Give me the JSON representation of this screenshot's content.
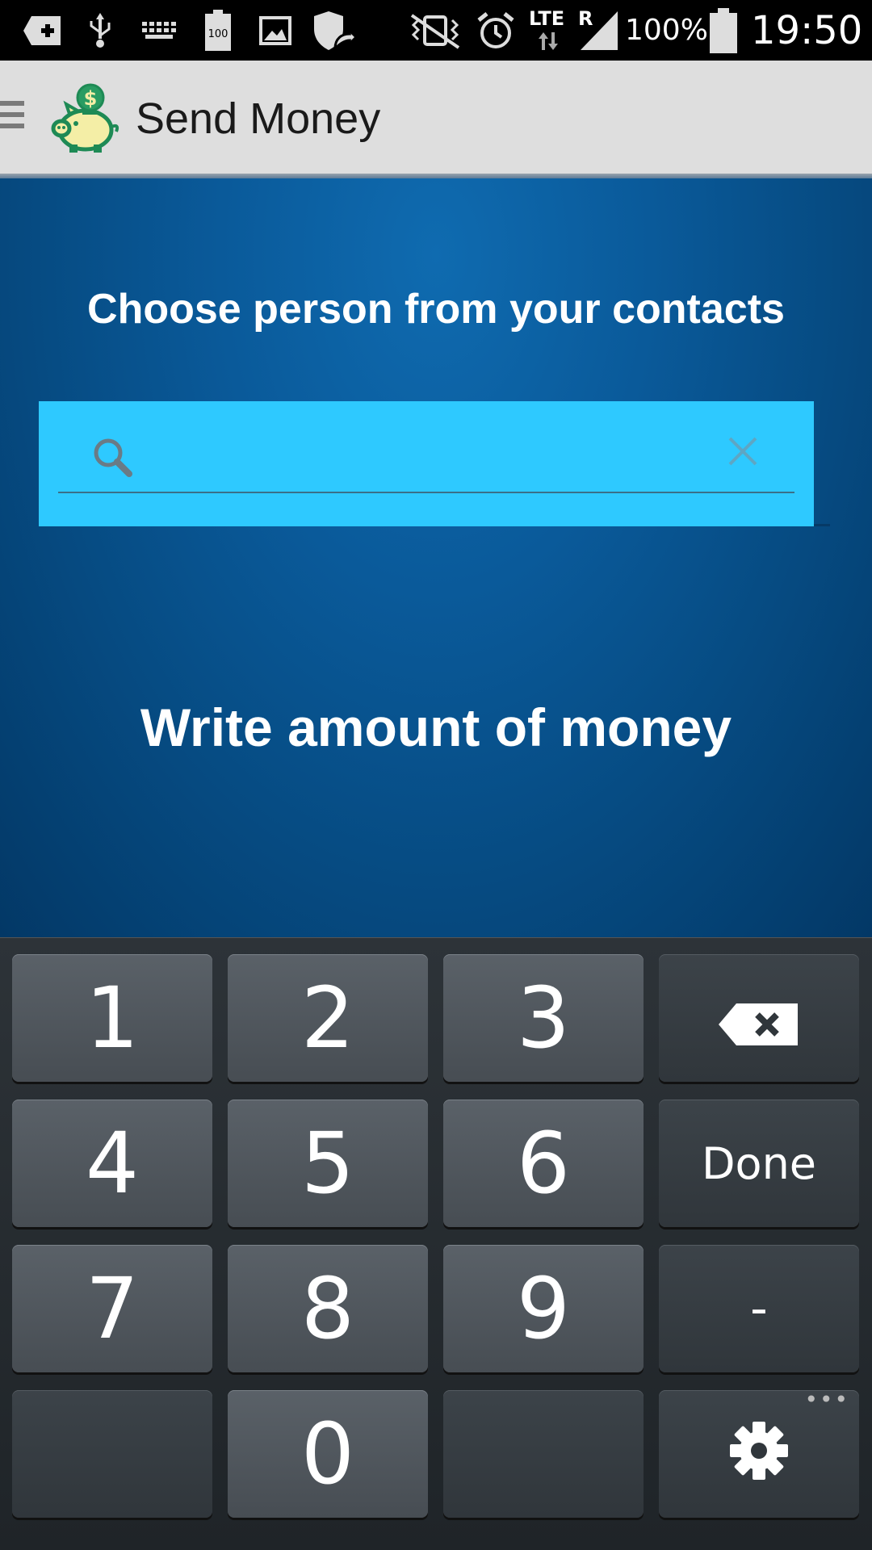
{
  "status_bar": {
    "battery_percent": "100%",
    "time": "19:50",
    "network_type": "LTE",
    "roaming": "R",
    "battery_small_label": "100",
    "icons": [
      "plus-icon",
      "usb-icon",
      "keyboard-icon",
      "battery-small-icon",
      "image-icon",
      "shield-icon",
      "vibrate-icon",
      "alarm-icon",
      "lte-icon",
      "signal-icon",
      "battery-icon"
    ]
  },
  "action_bar": {
    "title": "Send Money",
    "logo_icon": "piggy-bank-icon",
    "menu_icon": "drawer-menu-icon"
  },
  "main": {
    "contacts_prompt": "Choose person from your contacts",
    "search": {
      "value": "",
      "placeholder": "",
      "search_icon": "search-icon",
      "clear_icon": "close-icon"
    },
    "amount_prompt": "Write amount of money"
  },
  "keyboard": {
    "keys": {
      "k1": "1",
      "k2": "2",
      "k3": "3",
      "k4": "4",
      "k5": "5",
      "k6": "6",
      "k7": "7",
      "k8": "8",
      "k9": "9",
      "k0": "0",
      "done": "Done",
      "dash": "-"
    },
    "backspace_icon": "backspace-icon",
    "settings_icon": "gear-icon"
  },
  "colors": {
    "action_bar_bg": "#dedede",
    "content_bg": "#0a5a9a",
    "search_bg": "#2ec9ff",
    "keyboard_bg": "#2a3035"
  }
}
